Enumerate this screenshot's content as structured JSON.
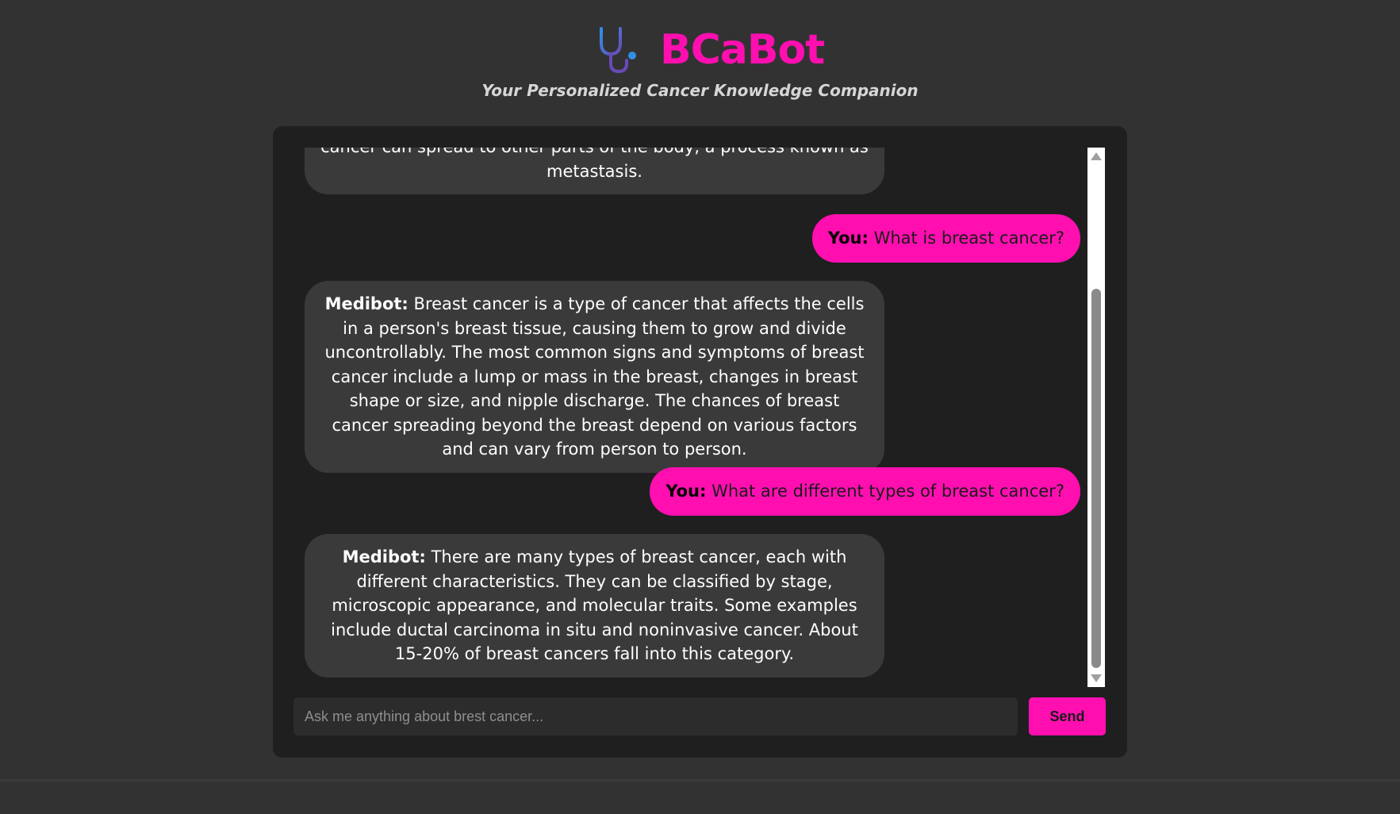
{
  "header": {
    "logo_icon": "stethoscope-icon",
    "title": "BCaBot",
    "subtitle": "Your Personalized Cancer Knowledge Companion",
    "title_color": "#ff0fb0"
  },
  "chat": {
    "messages": [
      {
        "role": "bot",
        "text": "cancer can spread to other parts of the body, a process known as metastasis."
      },
      {
        "role": "user",
        "speaker": "You:",
        "text": "What is breast cancer?"
      },
      {
        "role": "bot",
        "speaker": "Medibot:",
        "text": "Breast cancer is a type of cancer that affects the cells in a person's breast tissue, causing them to grow and divide uncontrollably. The most common signs and symptoms of breast cancer include a lump or mass in the breast, changes in breast shape or size, and nipple discharge. The chances of breast cancer spreading beyond the breast depend on various factors and can vary from person to person."
      },
      {
        "role": "user",
        "speaker": "You:",
        "text": "What are different types of breast cancer?"
      },
      {
        "role": "bot",
        "speaker": "Medibot:",
        "text": "There are many types of breast cancer, each with different characteristics. They can be classified by stage, microscopic appearance, and molecular traits. Some examples include ductal carcinoma in situ and noninvasive cancer. About 15-20% of breast cancers fall into this category."
      }
    ],
    "accent_color": "#ff0fb0",
    "bot_bubble_color": "#3a3a3a"
  },
  "input": {
    "placeholder": "Ask me anything about brest cancer...",
    "value": "",
    "send_label": "Send"
  }
}
